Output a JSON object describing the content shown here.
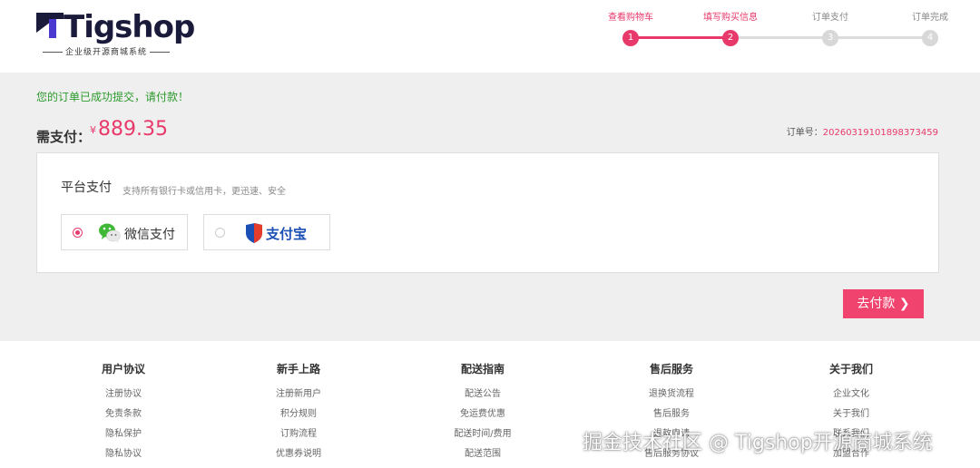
{
  "logo": {
    "brand": "Tigshop",
    "tagline": "企业级开源商城系统"
  },
  "steps": [
    {
      "label": "查看购物车",
      "num": "1",
      "active": true
    },
    {
      "label": "填写购买信息",
      "num": "2",
      "active": true
    },
    {
      "label": "订单支付",
      "num": "3",
      "active": false
    },
    {
      "label": "订单完成",
      "num": "4",
      "active": false
    }
  ],
  "main": {
    "success_msg": "您的订单已成功提交，请付款！",
    "pay_label": "需支付：",
    "currency": "¥",
    "amount": "889.35",
    "order_label": "订单号：",
    "order_no": "20260319101898373459"
  },
  "payment": {
    "title": "平台支付",
    "desc": "支持所有银行卡或信用卡，更迅速、安全",
    "wechat_label": "微信支付",
    "alipay_label": "支付宝",
    "submit_label": "去付款"
  },
  "footer": {
    "columns": [
      {
        "title": "用户协议",
        "links": [
          "注册协议",
          "免责条款",
          "隐私保护",
          "隐私协议"
        ]
      },
      {
        "title": "新手上路",
        "links": [
          "注册新用户",
          "积分规则",
          "订购流程",
          "优惠券说明"
        ]
      },
      {
        "title": "配送指南",
        "links": [
          "配送公告",
          "免运费优惠",
          "配送时间/费用",
          "配送范围"
        ]
      },
      {
        "title": "售后服务",
        "links": [
          "退换货流程",
          "售后服务",
          "退款申请",
          "售后服务协议"
        ]
      },
      {
        "title": "关于我们",
        "links": [
          "企业文化",
          "关于我们",
          "联系我们",
          "加盟合作"
        ]
      }
    ]
  },
  "watermark": "掘金技术社区 @ Tigshop开源商城系统",
  "colors": {
    "accent": "#e8396b",
    "success": "#2c9a2c",
    "button": "#f0446f"
  }
}
